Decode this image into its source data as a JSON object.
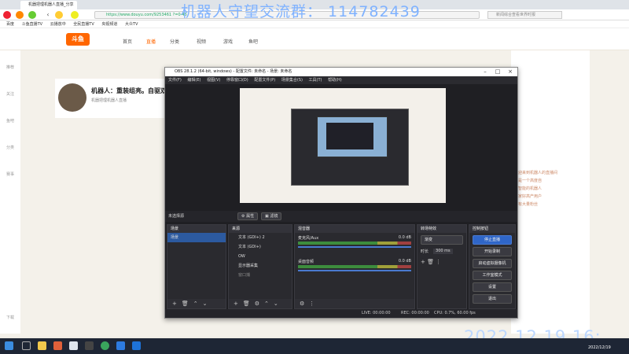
{
  "browser": {
    "tab_label": "机器把理机器人直播_分享",
    "url": "https://www.douyu.com/9253461 ?=0-45",
    "search_placeholder": "新闻综合查看世界时报",
    "bookmarks": [
      "百度",
      "斗鱼直播TV",
      "云播放中",
      "全民直播TV",
      "央视频道",
      "大众TV"
    ]
  },
  "watermark": "机器人守望交流群：  114782439",
  "site": {
    "logo": "斗鱼",
    "nav": [
      "首页",
      "直播",
      "分类",
      "视频",
      "游戏",
      "鱼吧"
    ],
    "left_items": [
      "推荐",
      "关注",
      "鱼吧",
      "分类",
      "赛事",
      "下载"
    ],
    "room_title": "机器人：重装组亮。自驱双曾",
    "room_sub": "机器把理机器人直播",
    "chat_lines": [
      "欢迎来到机器人的直播间",
      "这是一个高度自",
      "主智能的机器人",
      "大家好高产用户",
      "的有大量粉丝"
    ]
  },
  "obs": {
    "title": "OBS 28.1.2 (64-bit, windows) - 配置文件: 未命名 - 场景: 未命名",
    "menu": [
      "文件(F)",
      "编辑(E)",
      "视图(V)",
      "停靠窗口(D)",
      "配置文件(P)",
      "场景集合(S)",
      "工具(T)",
      "帮助(H)"
    ],
    "no_source": "未选择源",
    "props_btn": "属性",
    "filter_btn": "滤镜",
    "docks": {
      "scenes": {
        "title": "场景",
        "items": [
          "场景"
        ]
      },
      "sources": {
        "title": "来源",
        "items": [
          "文本 (GDI+) 2",
          "文本 (GDI+)",
          "OW",
          "显示器采集",
          "窗口捕"
        ]
      },
      "mixer": {
        "title": "混音器",
        "channels": [
          {
            "name": "麦克风/Aux",
            "db": "0.0 dB"
          },
          {
            "name": "桌面音频",
            "db": "0.0 dB"
          }
        ]
      },
      "transitions": {
        "title": "转场特效",
        "type": "渐变",
        "duration_label": "时长",
        "duration": "300 ms"
      },
      "controls": {
        "title": "控制按钮",
        "buttons": [
          "停止直播",
          "开始录制",
          "启动虚拟摄像机",
          "工作室模式",
          "设置",
          "退出"
        ]
      }
    },
    "status": {
      "live": "LIVE: 00:00:00",
      "rec": "REC: 00:00:00",
      "cpu": "CPU: 0.7%, 60.00 fps"
    }
  },
  "clock_overlay": "2022.12.19 16:",
  "taskbar": {
    "time": "2022/12/19"
  }
}
